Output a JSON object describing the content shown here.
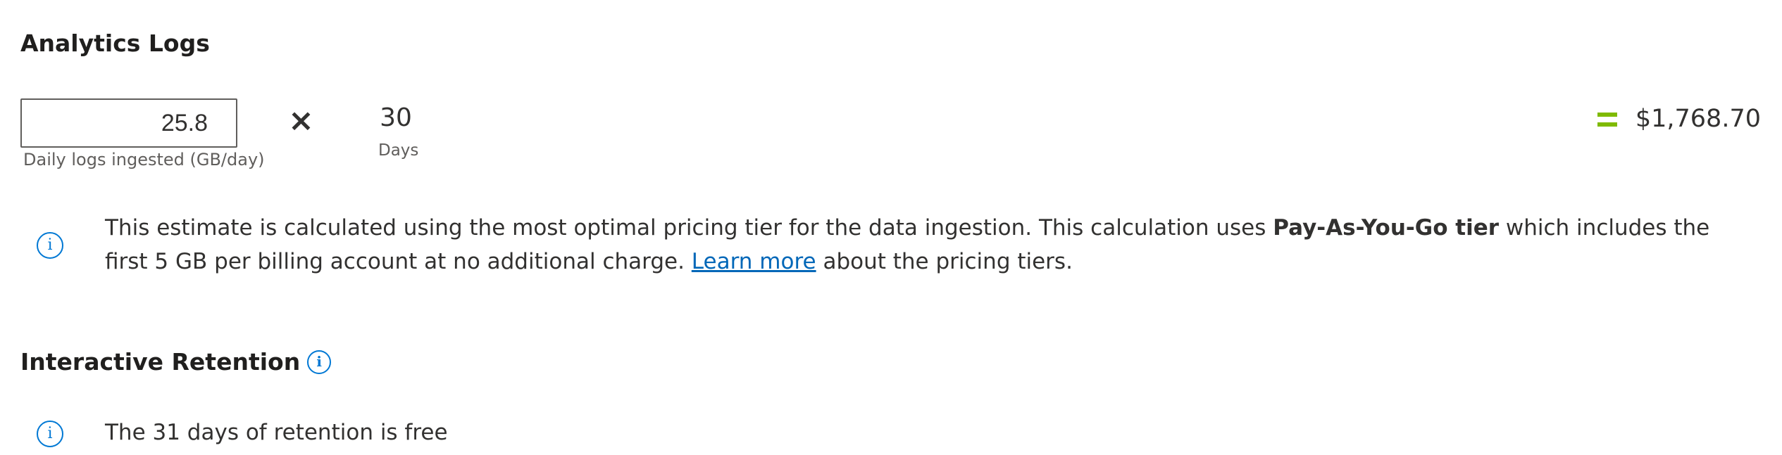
{
  "analytics_logs": {
    "title": "Analytics Logs",
    "daily_ingest": {
      "value": "25.8",
      "caption": "Daily logs ingested (GB/day)"
    },
    "multiply_symbol": "×",
    "days": {
      "value": "30",
      "label": "Days"
    },
    "equals_symbol": "=",
    "total": "$1,768.70",
    "info_icon": "info-icon",
    "estimate_note": {
      "text_before": "This estimate is calculated using the most optimal pricing tier for the data ingestion. This calculation uses ",
      "bold_tier": "Pay-As-You-Go tier",
      "text_middle": " which includes the first 5 GB per billing account at no additional charge. ",
      "link_label": "Learn more",
      "text_after": " about the pricing tiers."
    },
    "accent_colors": {
      "info": "#0078d4",
      "equals": "#7fba00",
      "link": "#0067b8"
    }
  },
  "interactive_retention": {
    "title": "Interactive Retention",
    "title_icon": "info-icon",
    "note_icon": "info-icon",
    "note": "The 31 days of retention is free"
  }
}
